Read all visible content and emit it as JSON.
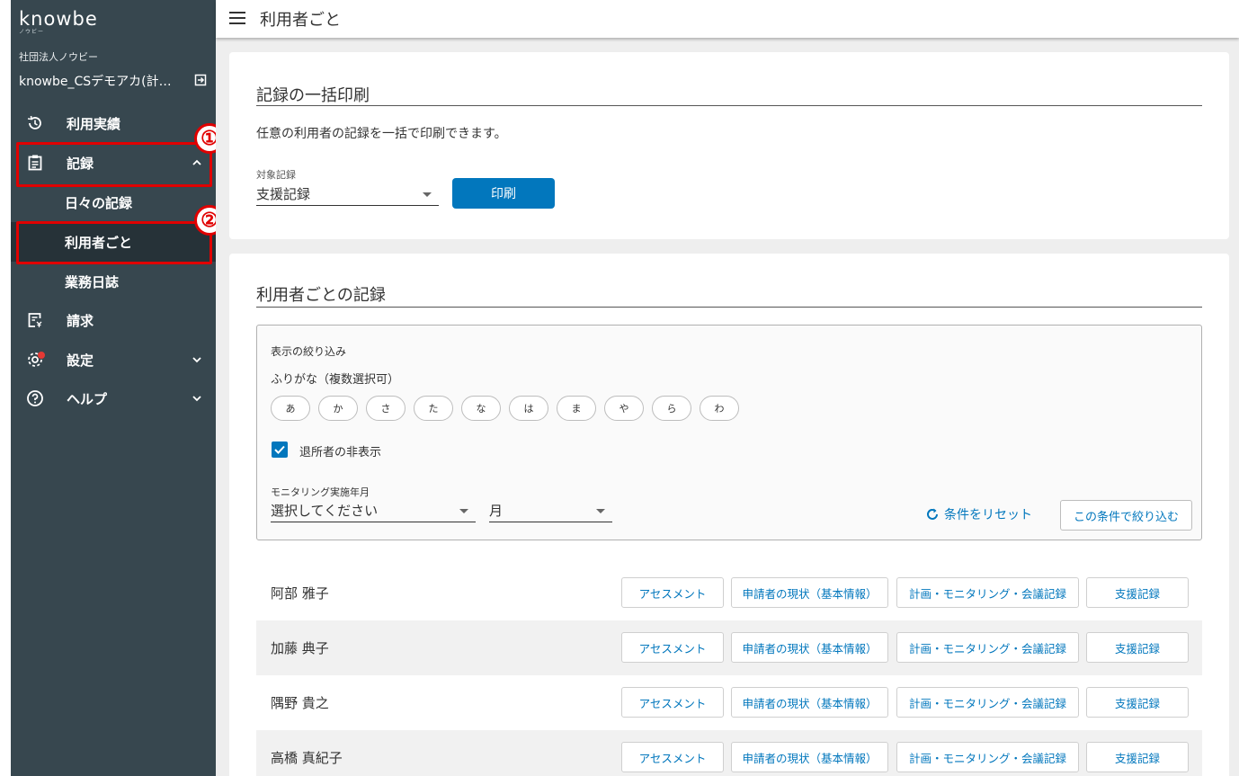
{
  "app": {
    "logo": "knowbe",
    "logo_sub": "ノウビー",
    "facility_label": "社団法人ノウビー",
    "facility_name": "knowbe_CSデモアカ(計…"
  },
  "sidebar": {
    "items": [
      {
        "label": "利用実績",
        "icon": "history-icon"
      },
      {
        "label": "記録",
        "icon": "clipboard-icon",
        "expanded": true
      },
      {
        "label": "日々の記録"
      },
      {
        "label": "利用者ごと",
        "active": true
      },
      {
        "label": "業務日誌"
      },
      {
        "label": "請求",
        "icon": "invoice-icon"
      },
      {
        "label": "設定",
        "icon": "gear-icon",
        "badge": true
      },
      {
        "label": "ヘルプ",
        "icon": "help-icon"
      }
    ]
  },
  "callouts": [
    "①",
    "②"
  ],
  "header": {
    "title": "利用者ごと"
  },
  "bulk_print": {
    "title": "記録の一括印刷",
    "description": "任意の利用者の記録を一括で印刷できます。",
    "target_label": "対象記録",
    "target_value": "支援記録",
    "print_button": "印刷"
  },
  "records": {
    "title": "利用者ごとの記録",
    "filter": {
      "heading": "表示の絞り込み",
      "furigana_label": "ふりがな（複数選択可）",
      "kana": [
        "あ",
        "か",
        "さ",
        "た",
        "な",
        "は",
        "ま",
        "や",
        "ら",
        "わ"
      ],
      "hide_retired_label": "退所者の非表示",
      "hide_retired_checked": true,
      "monitoring_label": "モニタリング実施年月",
      "year_placeholder": "選択してください",
      "month_placeholder": "月",
      "reset_label": "条件をリセット",
      "apply_label": "この条件で絞り込む"
    },
    "row_buttons": [
      "アセスメント",
      "申請者の現状（基本情報）",
      "計画・モニタリング・会議記録",
      "支援記録"
    ],
    "users": [
      {
        "name": "阿部 雅子"
      },
      {
        "name": "加藤 典子"
      },
      {
        "name": "隅野 貴之"
      },
      {
        "name": "高橋 真紀子"
      }
    ]
  },
  "colors": {
    "sidebar_bg": "#37474f",
    "accent": "#0277bd",
    "callout": "#e00000"
  }
}
